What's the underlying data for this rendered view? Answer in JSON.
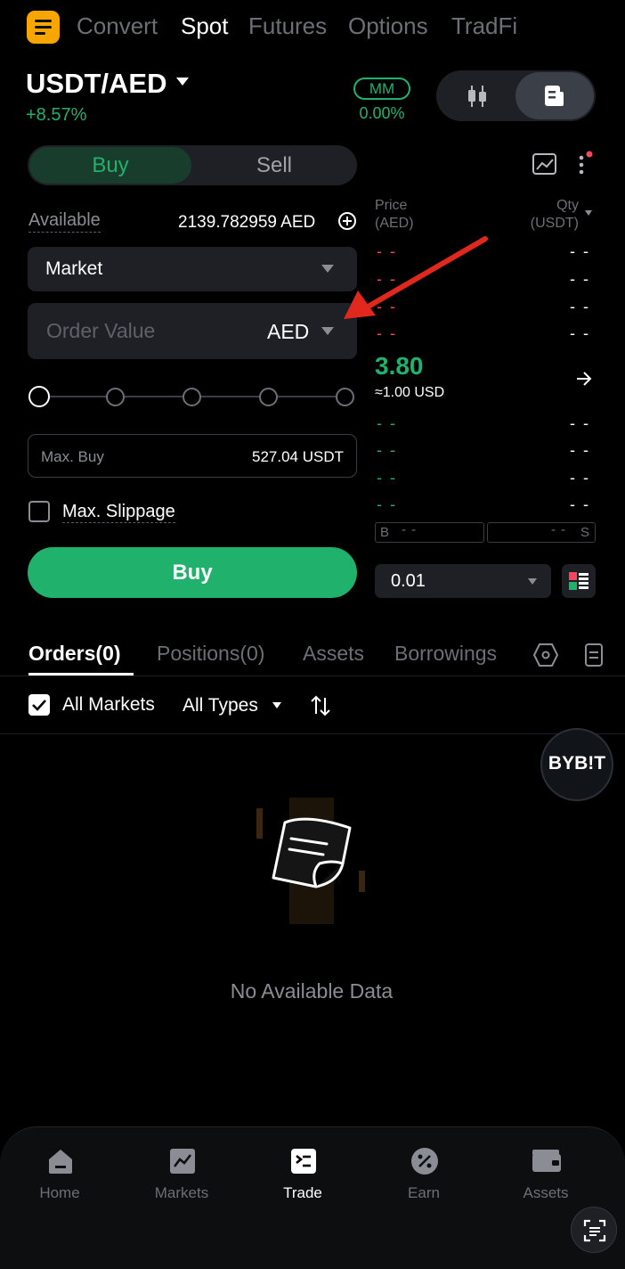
{
  "top_tabs": [
    "Convert",
    "Spot",
    "Futures",
    "Options",
    "TradFi"
  ],
  "pair": {
    "name": "USDT/AED",
    "change": "+8.57%"
  },
  "mm": {
    "label": "MM",
    "value": "0.00%"
  },
  "buy_sell": {
    "buy": "Buy",
    "sell": "Sell"
  },
  "available": {
    "label": "Available",
    "value": "2139.782959 AED"
  },
  "order_type": "Market",
  "order_value": {
    "placeholder": "Order Value",
    "currency": "AED"
  },
  "max_buy": {
    "label": "Max. Buy",
    "value": "527.04 USDT"
  },
  "slippage_label": "Max. Slippage",
  "buy_button": "Buy",
  "order_book": {
    "price_header": "Price",
    "price_unit": "(AED)",
    "qty_header": "Qty",
    "qty_unit": "(USDT)",
    "last_price": "3.80",
    "usd_equiv": "≈1.00 USD",
    "dash": "- -",
    "buy_letter": "B",
    "sell_letter": "S",
    "precision": "0.01"
  },
  "orders_tabs": [
    "Orders(0)",
    "Positions(0)",
    "Assets",
    "Borrowings"
  ],
  "filters": {
    "all_markets": "All Markets",
    "all_types": "All Types"
  },
  "empty_text": "No Available Data",
  "bybit_logo": "BYB!T",
  "nav": [
    "Home",
    "Markets",
    "Trade",
    "Earn",
    "Assets"
  ],
  "colors": {
    "green": "#20b26c",
    "red": "#f6465d",
    "accent": "#f7a600",
    "arrow": "#e0281c"
  }
}
